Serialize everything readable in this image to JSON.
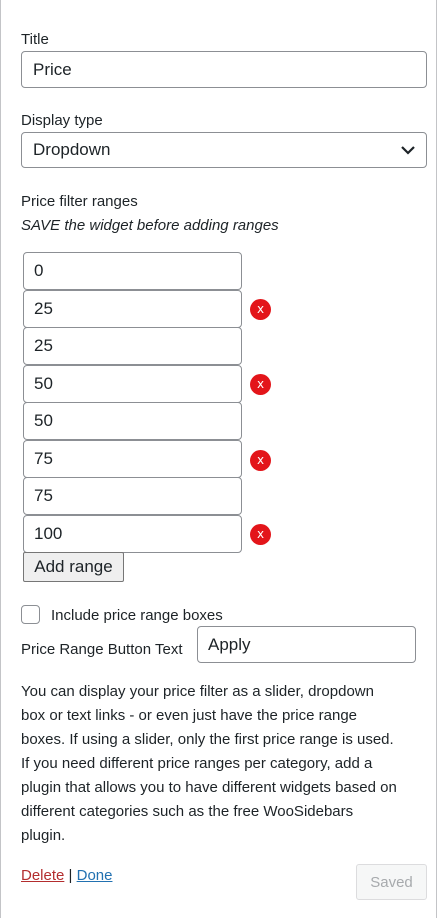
{
  "title_field": {
    "label": "Title",
    "value": "Price"
  },
  "display_type": {
    "label": "Display type",
    "value": "Dropdown"
  },
  "ranges": {
    "heading": "Price filter ranges",
    "note": "SAVE the widget before adding ranges",
    "inputs": [
      "0",
      "25",
      "25",
      "50",
      "50",
      "75",
      "75",
      "100"
    ],
    "remove_label": "x",
    "add_label": "Add range"
  },
  "include_boxes": {
    "label": "Include price range boxes",
    "checked": false
  },
  "button_text": {
    "label": "Price Range Button Text",
    "value": "Apply"
  },
  "description": "You can display your price filter as a slider, dropdown box or text links - or even just have the price range boxes. If using a slider, only the first price range is used. If you need different price ranges per category, add a plugin that allows you to have different widgets based on different categories such as the free WooSidebars plugin.",
  "footer": {
    "delete_label": "Delete",
    "separator": "|",
    "done_label": "Done",
    "saved_label": "Saved"
  },
  "colors": {
    "remove": "#e3151a",
    "delete_link": "#b32d2e",
    "done_link": "#2271b1"
  },
  "icons": {
    "select_arrow": "chevron-down-icon"
  }
}
